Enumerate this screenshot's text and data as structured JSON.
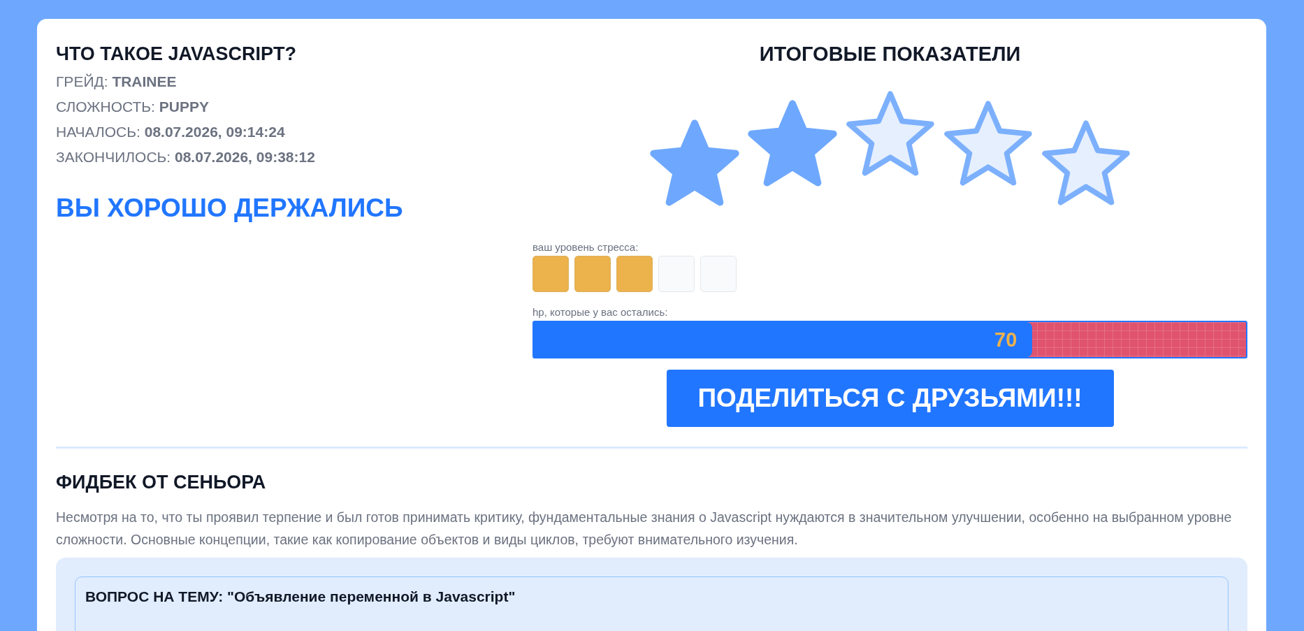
{
  "topic": {
    "title": "ЧТО ТАКОЕ JAVASCRIPT?",
    "meta": [
      {
        "label": "ГРЕЙД:",
        "value": "TRAINEE"
      },
      {
        "label": "СЛОЖНОСТЬ:",
        "value": "PUPPY"
      },
      {
        "label": "НАЧАЛОСЬ:",
        "value": "08.07.2026, 09:14:24"
      },
      {
        "label": "ЗАКОНЧИЛОСЬ:",
        "value": "08.07.2026, 09:38:12"
      }
    ],
    "verdict": "ВЫ ХОРОШО ДЕРЖАЛИСЬ"
  },
  "results": {
    "title": "ИТОГОВЫЕ ПОКАЗАТЕЛИ",
    "stars": 2,
    "stress": {
      "label": "ваш уровень стресса:",
      "cells": [
        {
          "on": true
        },
        {
          "on": true
        },
        {
          "on": true
        },
        {
          "on": false
        },
        {
          "on": false
        }
      ]
    },
    "hp": {
      "label": "hp, которые у вас остались:",
      "level": 0.7,
      "reading": "70"
    },
    "share_button": "ПОДЕЛИТЬСЯ С ДРУЗЬЯМИ!!!"
  },
  "feedback": {
    "title": "ФИДБЕК ОТ СЕНЬОРА",
    "text": "Несмотря на то, что ты проявил терпение и был готов принимать критику, фундаментальные знания о Javascript нуждаются в значительном улучшении, особенно на выбранном уровне сложности. Основные концепции, такие как копирование объектов и виды циклов, требуют внимательного изучения.",
    "questions": [
      {
        "title": "ВОПРОС НА ТЕМУ: \"Объявление переменной в Javascript\""
      }
    ]
  }
}
